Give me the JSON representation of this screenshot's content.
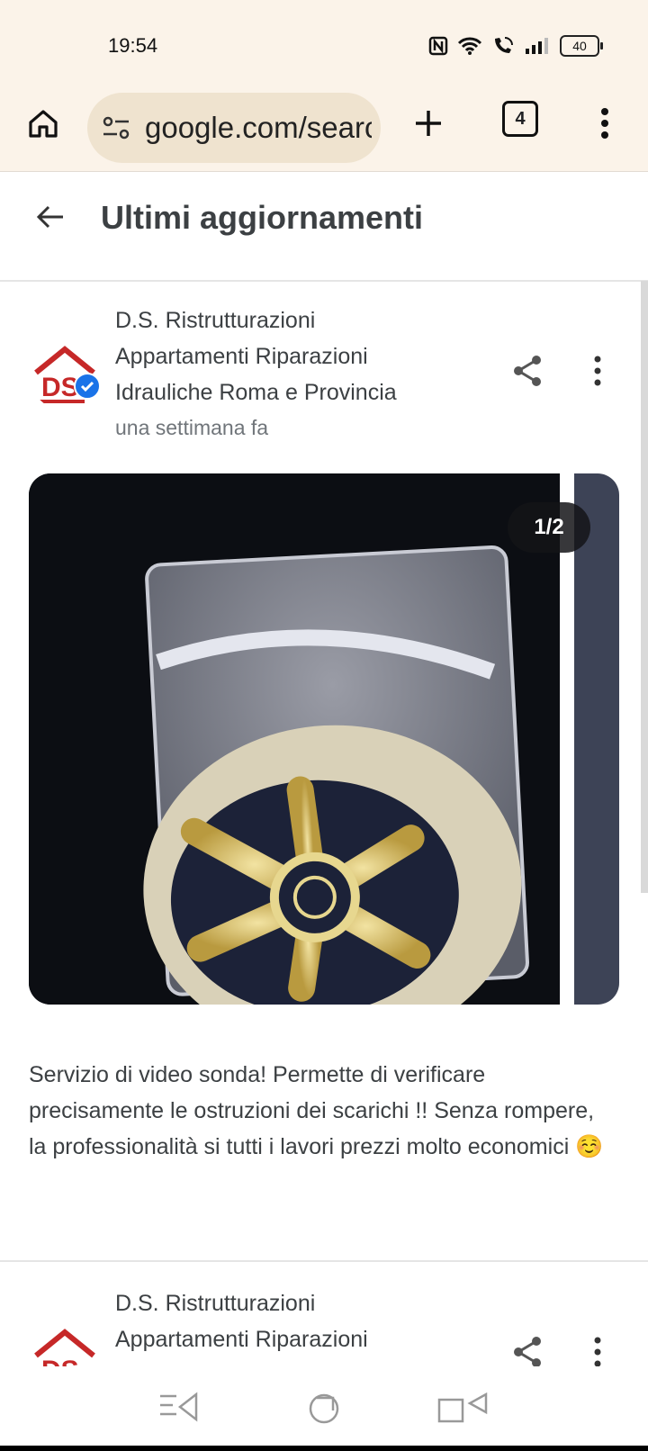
{
  "status": {
    "time": "19:54",
    "battery": "40"
  },
  "browser": {
    "url": "google.com/search",
    "tab_count": "4"
  },
  "page": {
    "title": "Ultimi aggiornamenti"
  },
  "posts": [
    {
      "business_name": "D.S. Ristrutturazioni Appartamenti Riparazioni Idrauliche Roma e Provincia",
      "time": "una settimana fa",
      "media_counter": "1/2",
      "text": "Servizio di video sonda! Permette di verificare precisamente le ostruzioni dei scarichi !! Senza rompere, la professionalità si tutti i lavori prezzi molto economici ☺️"
    },
    {
      "business_name": "D.S. Ristrutturazioni Appartamenti Riparazioni Idrauliche Roma e Provincia"
    }
  ],
  "colors": {
    "chrome_bg": "#fbf3e9",
    "url_pill": "#efe3cf",
    "verified": "#1a73e8",
    "logo_red": "#c62828"
  }
}
